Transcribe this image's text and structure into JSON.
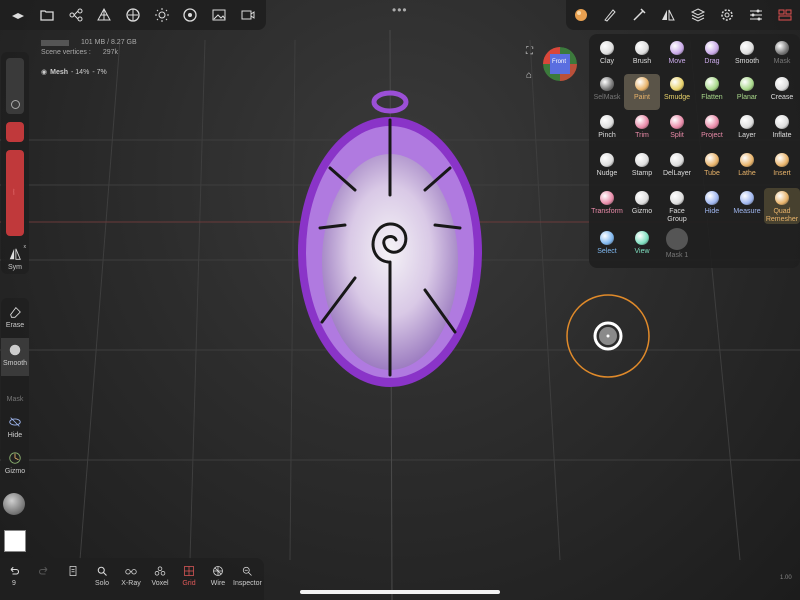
{
  "stats": {
    "memory": "101 MB / 8.27 GB",
    "vertices_label": "Scene vertices :",
    "vertices_value": "297k"
  },
  "mesh_info": {
    "label": "Mesh",
    "value_a": "- 14%",
    "value_b": "- 7%"
  },
  "top_dots": "•••",
  "view_cube": {
    "label": "Front"
  },
  "top_left_icons": [
    "layers-stack-icon",
    "folder-icon",
    "scene-graph-icon",
    "topology-icon",
    "material-icon",
    "sun-icon",
    "environment-icon",
    "image-icon",
    "camera-icon"
  ],
  "top_right_icons": [
    "paint-ball-icon",
    "brush-icon",
    "stroke-icon",
    "symmetry-icon",
    "layers-icon",
    "settings-icon",
    "sliders-icon",
    "interface-icon"
  ],
  "left_toolbar": {
    "sym_label": "Sym",
    "sym_sup": "x",
    "erase_label": "Erase",
    "smooth_label": "Smooth",
    "mask_label": "Mask",
    "hide_label": "Hide",
    "gizmo_label": "Gizmo"
  },
  "bottom_toolbar": {
    "undo_count": "9",
    "items": [
      {
        "label": "Solo"
      },
      {
        "label": "X-Ray"
      },
      {
        "label": "Voxel"
      },
      {
        "label": "Grid"
      },
      {
        "label": "Wire"
      },
      {
        "label": "Inspector"
      }
    ]
  },
  "version": "1.00",
  "tools": {
    "rows": [
      [
        {
          "label": "Clay",
          "color": "#dddddd"
        },
        {
          "label": "Brush",
          "color": "#dddddd"
        },
        {
          "label": "Move",
          "color": "#c9a9e8"
        },
        {
          "label": "Drag",
          "color": "#c9a9e8"
        },
        {
          "label": "Smooth",
          "color": "#dddddd"
        },
        {
          "label": "Mask",
          "color": "#777777"
        }
      ],
      [
        {
          "label": "SelMask",
          "color": "#777777"
        },
        {
          "label": "Paint",
          "color": "#e8b36a"
        },
        {
          "label": "Smudge",
          "color": "#e8d26a"
        },
        {
          "label": "Flatten",
          "color": "#a8d88a"
        },
        {
          "label": "Planar",
          "color": "#a8d88a"
        },
        {
          "label": "Crease",
          "color": "#dddddd"
        }
      ],
      [
        {
          "label": "Pinch",
          "color": "#dddddd"
        },
        {
          "label": "Trim",
          "color": "#e88aa8"
        },
        {
          "label": "Split",
          "color": "#e88aa8"
        },
        {
          "label": "Project",
          "color": "#e88aa8"
        },
        {
          "label": "Layer",
          "color": "#dddddd"
        },
        {
          "label": "Inflate",
          "color": "#dddddd"
        }
      ],
      [
        {
          "label": "Nudge",
          "color": "#dddddd"
        },
        {
          "label": "Stamp",
          "color": "#dddddd"
        },
        {
          "label": "DelLayer",
          "color": "#dddddd"
        },
        {
          "label": "Tube",
          "color": "#e8b36a"
        },
        {
          "label": "Lathe",
          "color": "#e8b36a"
        },
        {
          "label": "Insert",
          "color": "#e8b36a"
        }
      ],
      [
        {
          "label": "Transform",
          "color": "#e88aa8"
        },
        {
          "label": "Gizmo",
          "color": "#dddddd"
        },
        {
          "label": "Face Group",
          "color": "#dddddd"
        },
        {
          "label": "Hide",
          "color": "#9fb6ef"
        },
        {
          "label": "Measure",
          "color": "#9fb6ef"
        },
        {
          "label": "Quad Remesher",
          "color": "#e8b36a"
        }
      ],
      [
        {
          "label": "Select",
          "color": "#7fb7ef"
        },
        {
          "label": "View",
          "color": "#7fe0c0"
        },
        {
          "label": "Mask 1",
          "color": "#777777"
        }
      ]
    ]
  },
  "colors": {
    "accent_orange": "#e08a2a",
    "mesh_purple": "#9b4fd6",
    "slider_red": "#c0393b"
  }
}
